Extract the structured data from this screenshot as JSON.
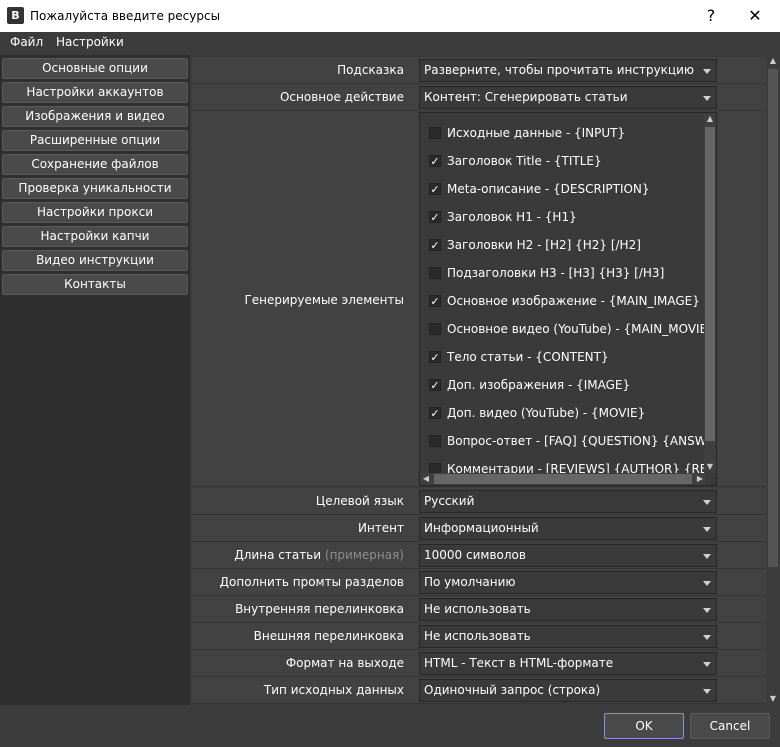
{
  "window": {
    "title": "Пожалуйста введите ресурсы",
    "icon_letter": "В",
    "help": "?",
    "close": "✕"
  },
  "menu": [
    "Файл",
    "Настройки"
  ],
  "sidebar": [
    "Основные опции",
    "Настройки аккаунтов",
    "Изображения и видео",
    "Расширенные опции",
    "Сохранение файлов",
    "Проверка уникальности",
    "Настройки прокси",
    "Настройки капчи",
    "Видео инструкции",
    "Контакты"
  ],
  "rows_top": [
    {
      "label": "Подсказка",
      "value": "Разверните, чтобы прочитать инструкцию"
    },
    {
      "label": "Основное действие",
      "value": "Контент: Сгенерировать статьи"
    }
  ],
  "elements": {
    "label": "Генерируемые элементы",
    "items": [
      {
        "text": "Исходные данные - {INPUT}",
        "checked": false
      },
      {
        "text": "Заголовок Title - {TITLE}",
        "checked": true
      },
      {
        "text": "Meta-описание - {DESCRIPTION}",
        "checked": true
      },
      {
        "text": "Заголовок H1 - {H1}",
        "checked": true
      },
      {
        "text": "Заголовки H2 - [H2] {H2} [/H2]",
        "checked": true
      },
      {
        "text": "Подзаголовки H3 - [H3] {H3} [/H3]",
        "checked": false
      },
      {
        "text": "Основное изображение - {MAIN_IMAGE}",
        "checked": true
      },
      {
        "text": "Основное видео (YouTube) - {MAIN_MOVIE}",
        "checked": false
      },
      {
        "text": "Тело статьи - {CONTENT}",
        "checked": true
      },
      {
        "text": "Доп. изображения - {IMAGE}",
        "checked": true
      },
      {
        "text": "Доп. видео (YouTube) - {MOVIE}",
        "checked": true
      },
      {
        "text": "Вопрос-ответ - [FAQ] {QUESTION} {ANSWER}",
        "checked": false
      },
      {
        "text": "Комментарии - [REVIEWS] {AUTHOR} {REVIEW}",
        "checked": false
      }
    ]
  },
  "rows_bottom": [
    {
      "label": "Целевой язык",
      "hint": "",
      "value": "Русский"
    },
    {
      "label": "Интент",
      "hint": "",
      "value": "Информационный"
    },
    {
      "label": "Длина статьи",
      "hint": "(примерная)",
      "value": "10000 символов"
    },
    {
      "label": "Дополнить промты разделов",
      "hint": "",
      "value": "По умолчанию"
    },
    {
      "label": "Внутренняя перелинковка",
      "hint": "",
      "value": "Не использовать"
    },
    {
      "label": "Внешняя перелинковка",
      "hint": "",
      "value": "Не использовать"
    },
    {
      "label": "Формат на выходе",
      "hint": "",
      "value": "HTML - Текст в HTML-формате"
    },
    {
      "label": "Тип исходных данных",
      "hint": "",
      "value": "Одиночный запрос (строка)"
    }
  ],
  "buttons": {
    "ok": "OK",
    "cancel": "Cancel"
  },
  "colors": {
    "background": "#3c3c3c",
    "accent_ok_border": "#8f8fd8"
  }
}
